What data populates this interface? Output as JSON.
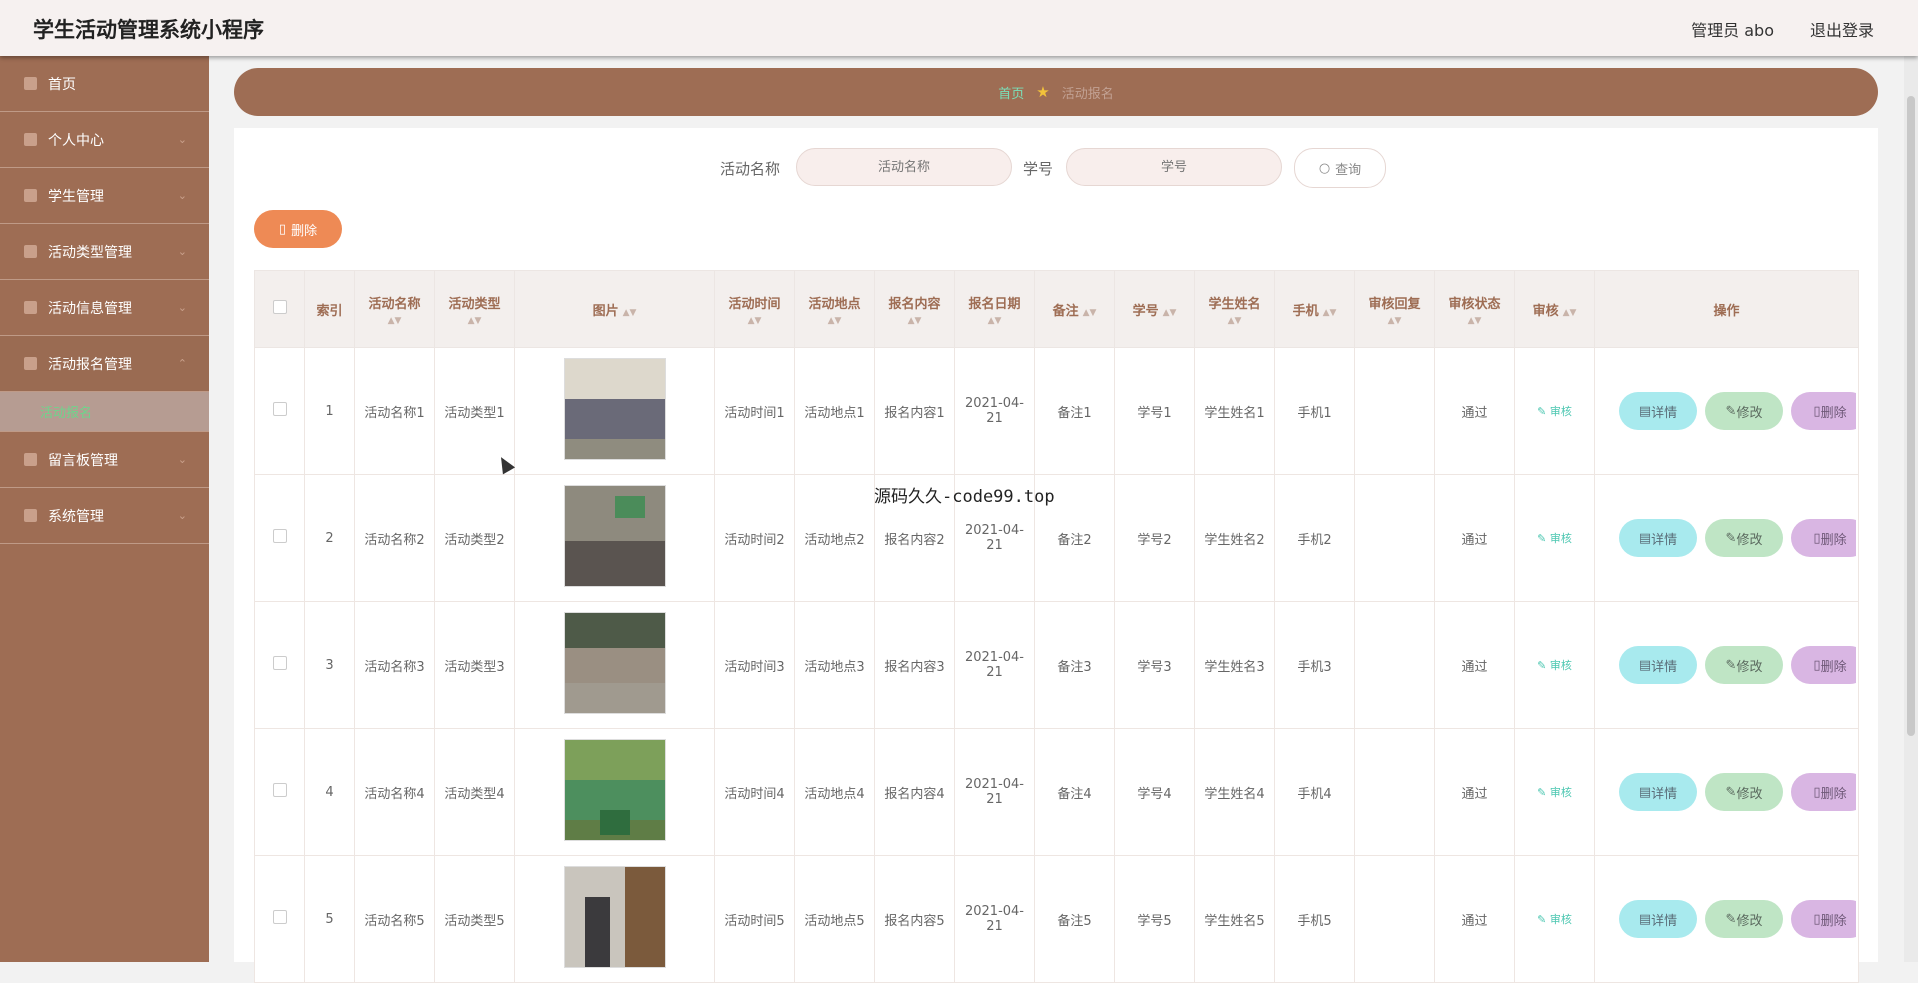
{
  "header": {
    "app_title": "学生活动管理系统小程序",
    "admin_label": "管理员 abo",
    "logout": "退出登录"
  },
  "sidebar": {
    "items": [
      {
        "label": "首页",
        "icon": "home-icon"
      },
      {
        "label": "个人中心",
        "icon": "user-icon"
      },
      {
        "label": "学生管理",
        "icon": "chart-icon"
      },
      {
        "label": "活动类型管理",
        "icon": "bank-icon"
      },
      {
        "label": "活动信息管理",
        "icon": "phone-icon"
      },
      {
        "label": "活动报名管理",
        "icon": "pen-icon"
      },
      {
        "label": "留言板管理",
        "icon": "building-icon"
      },
      {
        "label": "系统管理",
        "icon": "grid-icon"
      }
    ],
    "sub_item": "活动报名"
  },
  "breadcrumb": {
    "home": "首页",
    "current": "活动报名"
  },
  "search": {
    "name_label": "活动名称",
    "name_placeholder": "活动名称",
    "id_label": "学号",
    "id_placeholder": "学号",
    "query_button": "查询"
  },
  "toolbar": {
    "delete_label": "删除"
  },
  "table": {
    "headers": {
      "index": "索引",
      "activity_name": "活动名称",
      "activity_type": "活动类型",
      "picture": "图片",
      "activity_time": "活动时间",
      "activity_place": "活动地点",
      "signup_content": "报名内容",
      "signup_date": "报名日期",
      "remark": "备注",
      "student_no": "学号",
      "student_name": "学生姓名",
      "phone": "手机",
      "audit_reply": "审核回复",
      "audit_status": "审核状态",
      "audit": "审核",
      "operations": "操作"
    },
    "rows": [
      {
        "index": "1",
        "activity_name": "活动名称1",
        "activity_type": "活动类型1",
        "activity_time": "活动时间1",
        "activity_place": "活动地点1",
        "signup_content": "报名内容1",
        "signup_date": "2021-04-21",
        "remark": "备注1",
        "student_no": "学号1",
        "student_name": "学生姓名1",
        "phone": "手机1",
        "audit_reply": "",
        "audit_status": "通过",
        "audit": "审核",
        "detail": "详情",
        "edit": "修改",
        "delete": "删除"
      },
      {
        "index": "2",
        "activity_name": "活动名称2",
        "activity_type": "活动类型2",
        "activity_time": "活动时间2",
        "activity_place": "活动地点2",
        "signup_content": "报名内容2",
        "signup_date": "2021-04-21",
        "remark": "备注2",
        "student_no": "学号2",
        "student_name": "学生姓名2",
        "phone": "手机2",
        "audit_reply": "",
        "audit_status": "通过",
        "audit": "审核",
        "detail": "详情",
        "edit": "修改",
        "delete": "删除"
      },
      {
        "index": "3",
        "activity_name": "活动名称3",
        "activity_type": "活动类型3",
        "activity_time": "活动时间3",
        "activity_place": "活动地点3",
        "signup_content": "报名内容3",
        "signup_date": "2021-04-21",
        "remark": "备注3",
        "student_no": "学号3",
        "student_name": "学生姓名3",
        "phone": "手机3",
        "audit_reply": "",
        "audit_status": "通过",
        "audit": "审核",
        "detail": "详情",
        "edit": "修改",
        "delete": "删除"
      },
      {
        "index": "4",
        "activity_name": "活动名称4",
        "activity_type": "活动类型4",
        "activity_time": "活动时间4",
        "activity_place": "活动地点4",
        "signup_content": "报名内容4",
        "signup_date": "2021-04-21",
        "remark": "备注4",
        "student_no": "学号4",
        "student_name": "学生姓名4",
        "phone": "手机4",
        "audit_reply": "",
        "audit_status": "通过",
        "audit": "审核",
        "detail": "详情",
        "edit": "修改",
        "delete": "删除"
      },
      {
        "index": "5",
        "activity_name": "活动名称5",
        "activity_type": "活动类型5",
        "activity_time": "活动时间5",
        "activity_place": "活动地点5",
        "signup_content": "报名内容5",
        "signup_date": "2021-04-21",
        "remark": "备注5",
        "student_no": "学号5",
        "student_name": "学生姓名5",
        "phone": "手机5",
        "audit_reply": "",
        "audit_status": "通过",
        "audit": "审核",
        "detail": "详情",
        "edit": "修改",
        "delete": "删除"
      }
    ]
  },
  "watermark": {
    "center_text": "源码久久-code99.top"
  },
  "colors": {
    "sidebar": "#9e6d54",
    "topbar": "#f6f1f0",
    "accent_orange": "#ee8a55",
    "detail_btn": "#a8eaee",
    "edit_btn": "#bfe5c5",
    "delete_btn": "#d9b6e3"
  }
}
